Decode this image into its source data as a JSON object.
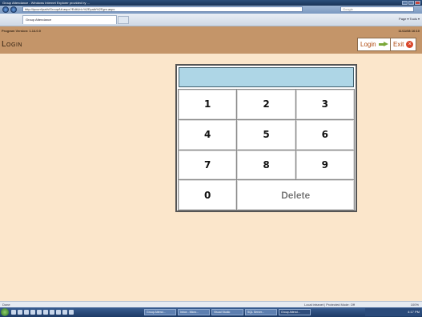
{
  "window": {
    "title": "Group Attendance - Windows Internet Explorer provided by ...",
    "address": "http://ipcurrl/path/GroupAtt.aspx?EditUrl=%2Fpath%2Fgm.aspx",
    "search_placeholder": "Google",
    "tab_label": "Group Attendance",
    "tools_label": "Page ▾  Tools ▾"
  },
  "app": {
    "version": "Program Version: 1.14.0.0",
    "datetime": "11/11/08 16:10",
    "page_title": "Login",
    "login_button": "Login",
    "exit_button": "Exit"
  },
  "keypad": {
    "display_value": "",
    "keys": [
      "1",
      "2",
      "3",
      "4",
      "5",
      "6",
      "7",
      "8",
      "9",
      "0"
    ],
    "delete_label": "Delete"
  },
  "statusbar": {
    "left": "Done",
    "zone": "Local intranet | Protected Mode: Off",
    "zoom": "100%"
  },
  "taskbar": {
    "tasks": [
      "Group Attend...",
      "Inbox - Micro...",
      "Visual Studio",
      "SQL Server...",
      "Group Attend..."
    ],
    "tray_time": "4:17 PM"
  },
  "colors": {
    "header_bg": "#c49569",
    "content_bg": "#fbe6cb",
    "display_bg": "#aed6e6",
    "accent": "#b04a10"
  },
  "icons": {
    "login": "arrow-right-icon",
    "exit": "exit-icon"
  }
}
